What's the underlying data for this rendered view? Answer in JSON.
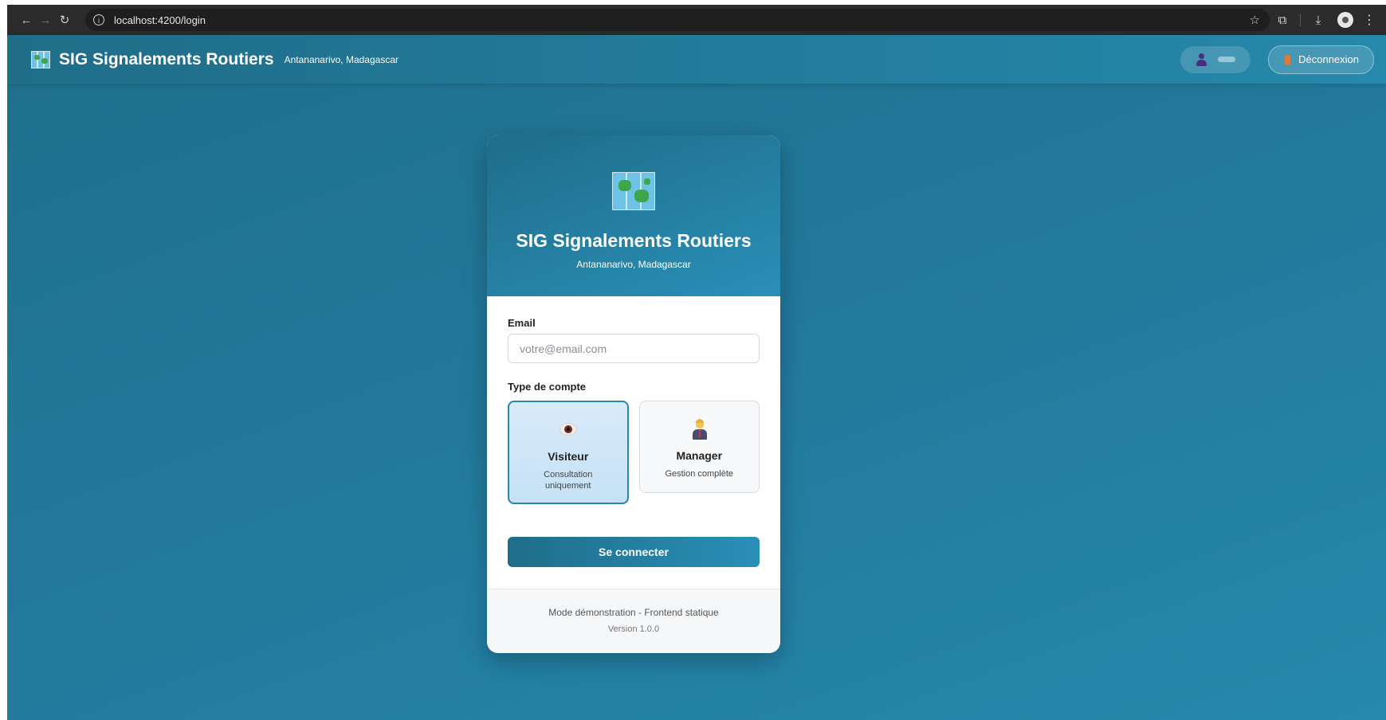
{
  "browser": {
    "url": "localhost:4200/login",
    "icons": [
      "back-arrow-icon",
      "forward-arrow-icon",
      "reload-icon",
      "info-icon",
      "star-icon",
      "extensions-icon",
      "download-icon",
      "profile-icon",
      "menu-icon"
    ]
  },
  "header": {
    "title": "SIG Signalements Routiers",
    "subtitle": "Antananarivo, Madagascar",
    "logout_label": "Déconnexion"
  },
  "login": {
    "title": "SIG Signalements Routiers",
    "subtitle": "Antananarivo, Madagascar",
    "email_label": "Email",
    "email_placeholder": "votre@email.com",
    "account_type_label": "Type de compte",
    "account_types": [
      {
        "name": "Visiteur",
        "description": "Consultation uniquement",
        "icon": "eye-icon",
        "selected": true
      },
      {
        "name": "Manager",
        "description": "Gestion complète",
        "icon": "manager-icon",
        "selected": false
      }
    ],
    "submit_label": "Se connecter",
    "footer_mode": "Mode démonstration - Frontend statique",
    "footer_version": "Version 1.0.0"
  },
  "colors": {
    "primary": "#1f6d89",
    "primary_light": "#2a8fb8",
    "selected_bg": "#d8ebfa",
    "selected_border": "#2a86ad"
  }
}
